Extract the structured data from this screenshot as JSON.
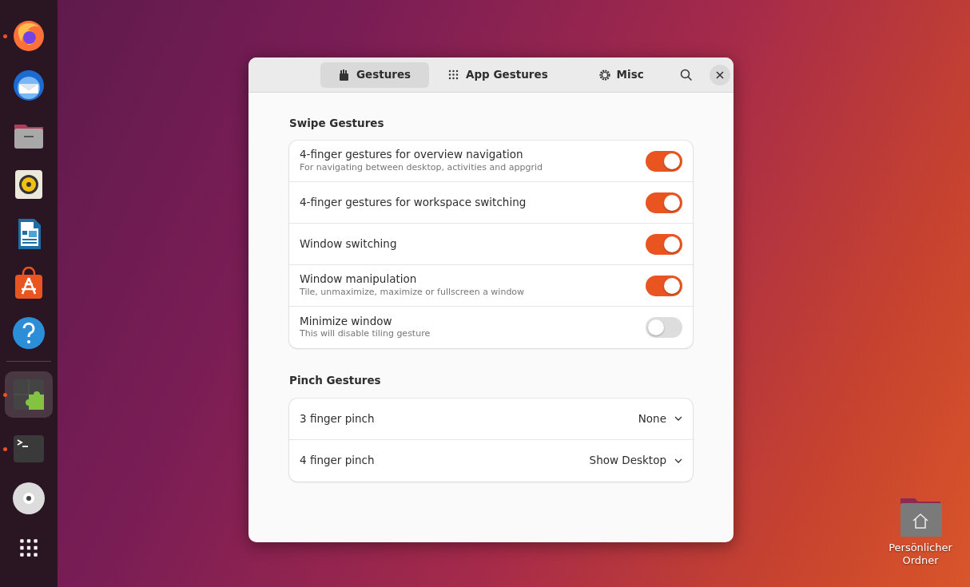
{
  "dock": {
    "items": [
      {
        "kind": "firefox",
        "running": true,
        "selected": false
      },
      {
        "kind": "thunderbird",
        "running": false,
        "selected": false
      },
      {
        "kind": "files",
        "running": false,
        "selected": false
      },
      {
        "kind": "rhythmbox",
        "running": false,
        "selected": false
      },
      {
        "kind": "writer",
        "running": false,
        "selected": false
      },
      {
        "kind": "appcenter",
        "running": false,
        "selected": false
      },
      {
        "kind": "help",
        "running": false,
        "selected": false
      },
      {
        "kind": "separator"
      },
      {
        "kind": "extensions",
        "running": true,
        "selected": true
      },
      {
        "kind": "terminal",
        "running": true,
        "selected": false
      },
      {
        "kind": "disc",
        "running": false,
        "selected": false
      },
      {
        "kind": "apps",
        "running": false,
        "selected": false
      }
    ]
  },
  "window": {
    "tabs": [
      {
        "kind": "gestures",
        "label": "Gestures",
        "selected": true
      },
      {
        "kind": "grid",
        "label": "App Gestures",
        "selected": false
      },
      {
        "kind": "gear",
        "label": "Misc",
        "selected": false
      }
    ],
    "sections": [
      {
        "title": "Swipe Gestures",
        "rows": [
          {
            "kind": "switch",
            "title": "4-finger gestures for overview navigation",
            "subtitle": "For navigating between desktop, activities and appgrid",
            "on": true
          },
          {
            "kind": "switch",
            "title": "4-finger gestures for workspace switching",
            "on": true
          },
          {
            "kind": "switch",
            "title": "Window switching",
            "on": true
          },
          {
            "kind": "switch",
            "title": "Window manipulation",
            "subtitle": "Tile, unmaximize, maximize or fullscreen a window",
            "on": true
          },
          {
            "kind": "switch",
            "title": "Minimize window",
            "subtitle": "This will disable tiling gesture",
            "on": false
          }
        ]
      },
      {
        "title": "Pinch Gestures",
        "rows": [
          {
            "kind": "dropdown",
            "title": "3 finger pinch",
            "value": "None"
          },
          {
            "kind": "dropdown",
            "title": "4 finger pinch",
            "value": "Show Desktop"
          }
        ]
      }
    ]
  },
  "desktop": {
    "icons": [
      {
        "label": "Persönlicher Ordner"
      }
    ]
  }
}
